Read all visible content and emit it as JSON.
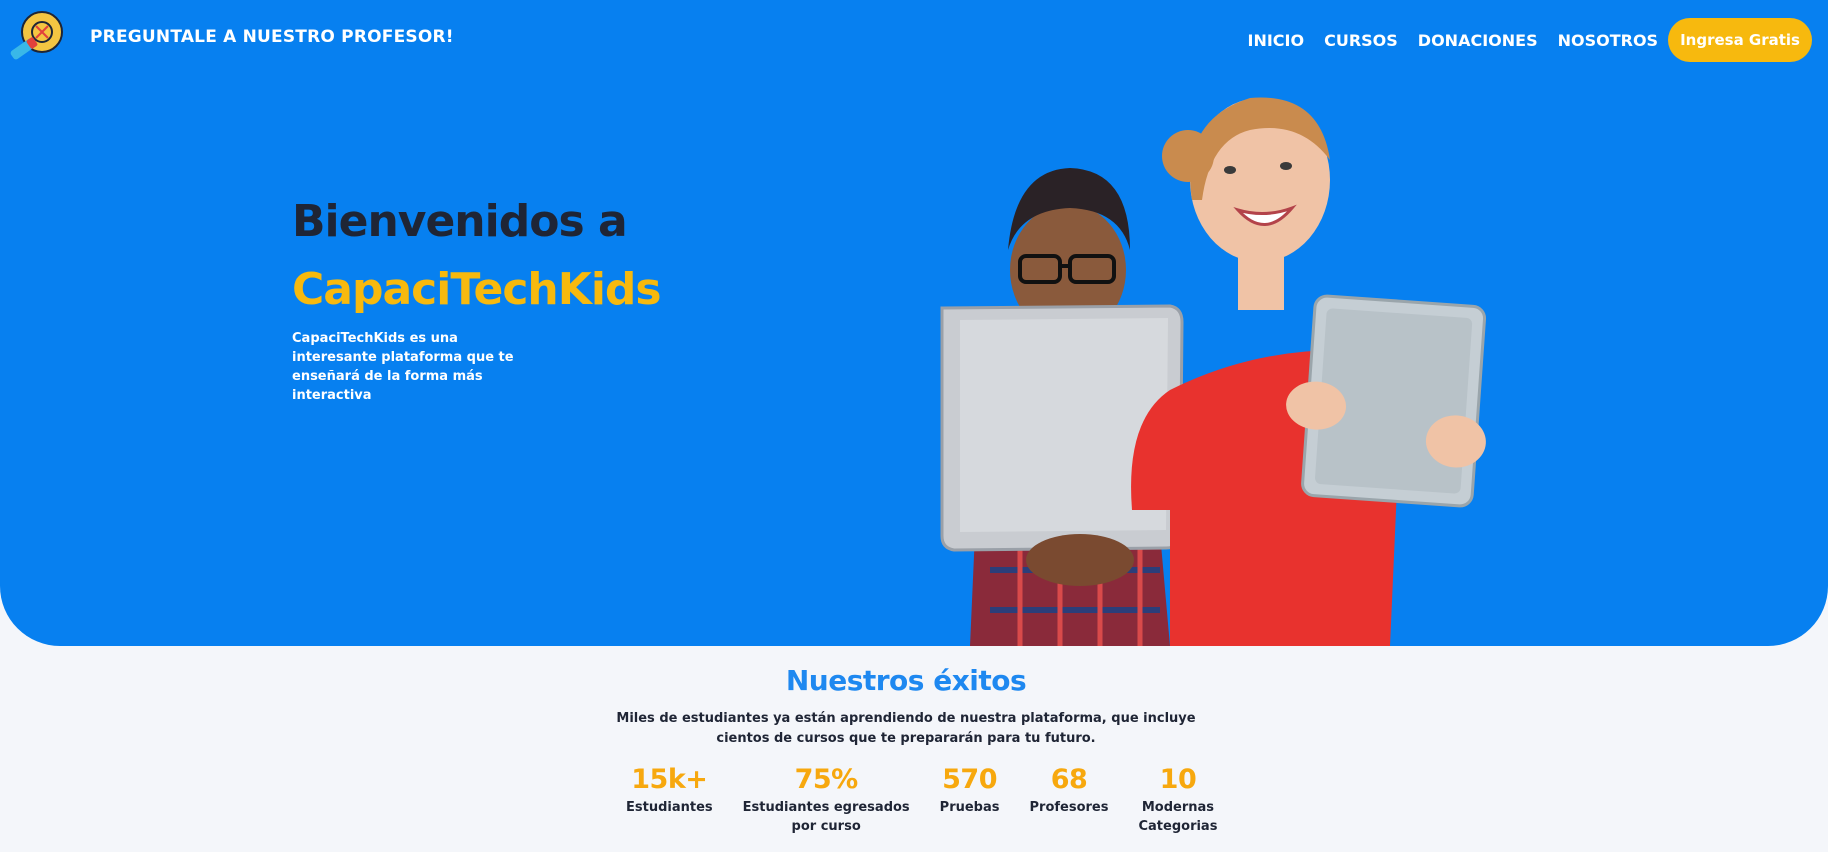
{
  "header": {
    "brand_text": "PREGUNTALE A NUESTRO PROFESOR!",
    "nav": [
      "INICIO",
      "CURSOS",
      "DONACIONES",
      "NOSOTROS"
    ],
    "cta_label": "Ingresa Gratis"
  },
  "hero": {
    "title_line1": "Bienvenidos a",
    "title_line2": "CapaciTechKids",
    "description": "CapaciTechKids es una interesante plataforma que te enseñará de la forma más interactiva"
  },
  "success": {
    "title": "Nuestros éxitos",
    "desc_line1": "Miles de estudiantes ya están aprendiendo de nuestra plataforma, que incluye",
    "desc_line2": "cientos de cursos que te prepararán para tu futuro.",
    "stats": [
      {
        "value": "15k+",
        "label": "Estudiantes"
      },
      {
        "value": "75%",
        "label": "Estudiantes egresados\npor curso"
      },
      {
        "value": "570",
        "label": "Pruebas"
      },
      {
        "value": "68",
        "label": "Profesores"
      },
      {
        "value": "10",
        "label": "Modernas\nCategorias"
      }
    ]
  },
  "colors": {
    "hero_bg": "#0780f0",
    "accent": "#f7b90e",
    "title_blue": "#1e88f0",
    "dark_text": "#1f2535"
  }
}
